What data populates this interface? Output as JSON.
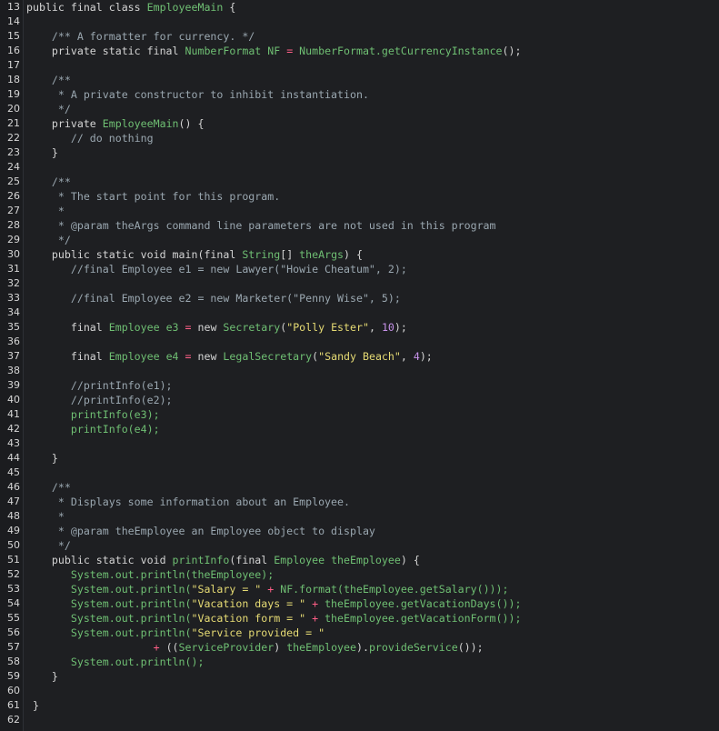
{
  "lines": [
    {
      "n": "13",
      "code": [
        [
          "kw",
          "public final class "
        ],
        [
          "ty",
          "EmployeeMain"
        ],
        [
          "pl",
          " {"
        ]
      ]
    },
    {
      "n": "14",
      "code": []
    },
    {
      "n": "15",
      "code": [
        [
          "cm",
          "    /** A formatter for currency. */"
        ]
      ]
    },
    {
      "n": "16",
      "code": [
        [
          "kw",
          "    private static final "
        ],
        [
          "ty",
          "NumberFormat NF "
        ],
        [
          "op",
          "="
        ],
        [
          "pl",
          " "
        ],
        [
          "ty",
          "NumberFormat.getCurrencyInstance"
        ],
        [
          "pl",
          "();"
        ]
      ]
    },
    {
      "n": "17",
      "code": []
    },
    {
      "n": "18",
      "code": [
        [
          "cm",
          "    /**"
        ]
      ]
    },
    {
      "n": "19",
      "code": [
        [
          "cm",
          "     * A private constructor to inhibit instantiation."
        ]
      ]
    },
    {
      "n": "20",
      "code": [
        [
          "cm",
          "     */"
        ]
      ]
    },
    {
      "n": "21",
      "code": [
        [
          "kw",
          "    private "
        ],
        [
          "ty",
          "EmployeeMain"
        ],
        [
          "pl",
          "() {"
        ]
      ]
    },
    {
      "n": "22",
      "code": [
        [
          "cm",
          "       // do nothing"
        ]
      ]
    },
    {
      "n": "23",
      "code": [
        [
          "pl",
          "    }"
        ]
      ]
    },
    {
      "n": "24",
      "code": []
    },
    {
      "n": "25",
      "code": [
        [
          "cm",
          "    /**"
        ]
      ]
    },
    {
      "n": "26",
      "code": [
        [
          "cm",
          "     * The start point for this program."
        ]
      ]
    },
    {
      "n": "27",
      "code": [
        [
          "cm",
          "     *"
        ]
      ]
    },
    {
      "n": "28",
      "code": [
        [
          "cm",
          "     * @param theArgs command line parameters are not used in this program"
        ]
      ]
    },
    {
      "n": "29",
      "code": [
        [
          "cm",
          "     */"
        ]
      ]
    },
    {
      "n": "30",
      "code": [
        [
          "kw",
          "    public static void "
        ],
        [
          "pl",
          "main(final "
        ],
        [
          "ty",
          "String"
        ],
        [
          "pl",
          "[] "
        ],
        [
          "ty",
          "theArgs"
        ],
        [
          "pl",
          ") {"
        ]
      ]
    },
    {
      "n": "31",
      "code": [
        [
          "cm",
          "       //final Employee e1 = new Lawyer(\"Howie Cheatum\", 2);"
        ]
      ]
    },
    {
      "n": "32",
      "code": []
    },
    {
      "n": "33",
      "code": [
        [
          "cm",
          "       //final Employee e2 = new Marketer(\"Penny Wise\", 5);"
        ]
      ]
    },
    {
      "n": "34",
      "code": []
    },
    {
      "n": "35",
      "code": [
        [
          "kw",
          "       final "
        ],
        [
          "ty",
          "Employee e3 "
        ],
        [
          "op",
          "="
        ],
        [
          "kw",
          " new "
        ],
        [
          "ty",
          "Secretary"
        ],
        [
          "pl",
          "("
        ],
        [
          "str",
          "\"Polly Ester\""
        ],
        [
          "pl",
          ", "
        ],
        [
          "num",
          "10"
        ],
        [
          "pl",
          ");"
        ]
      ]
    },
    {
      "n": "36",
      "code": []
    },
    {
      "n": "37",
      "code": [
        [
          "kw",
          "       final "
        ],
        [
          "ty",
          "Employee e4 "
        ],
        [
          "op",
          "="
        ],
        [
          "kw",
          " new "
        ],
        [
          "ty",
          "LegalSecretary"
        ],
        [
          "pl",
          "("
        ],
        [
          "str",
          "\"Sandy Beach\""
        ],
        [
          "pl",
          ", "
        ],
        [
          "num",
          "4"
        ],
        [
          "pl",
          ");"
        ]
      ]
    },
    {
      "n": "38",
      "code": []
    },
    {
      "n": "39",
      "code": [
        [
          "cm",
          "       //printInfo(e1);"
        ]
      ]
    },
    {
      "n": "40",
      "code": [
        [
          "cm",
          "       //printInfo(e2);"
        ]
      ]
    },
    {
      "n": "41",
      "code": [
        [
          "ty",
          "       printInfo(e3);"
        ]
      ]
    },
    {
      "n": "42",
      "code": [
        [
          "ty",
          "       printInfo(e4);"
        ]
      ]
    },
    {
      "n": "43",
      "code": []
    },
    {
      "n": "44",
      "code": [
        [
          "pl",
          "    }"
        ]
      ]
    },
    {
      "n": "45",
      "code": []
    },
    {
      "n": "46",
      "code": [
        [
          "cm",
          "    /**"
        ]
      ]
    },
    {
      "n": "47",
      "code": [
        [
          "cm",
          "     * Displays some information about an Employee."
        ]
      ]
    },
    {
      "n": "48",
      "code": [
        [
          "cm",
          "     *"
        ]
      ]
    },
    {
      "n": "49",
      "code": [
        [
          "cm",
          "     * @param theEmployee an Employee object to display"
        ]
      ]
    },
    {
      "n": "50",
      "code": [
        [
          "cm",
          "     */"
        ]
      ]
    },
    {
      "n": "51",
      "code": [
        [
          "kw",
          "    public static void "
        ],
        [
          "ty",
          "printInfo"
        ],
        [
          "pl",
          "(final "
        ],
        [
          "ty",
          "Employee theEmployee"
        ],
        [
          "pl",
          ") {"
        ]
      ]
    },
    {
      "n": "52",
      "code": [
        [
          "ty",
          "       System.out.println(theEmployee);"
        ]
      ]
    },
    {
      "n": "53",
      "code": [
        [
          "ty",
          "       System.out.println("
        ],
        [
          "str",
          "\"Salary = \""
        ],
        [
          "op",
          " + "
        ],
        [
          "ty",
          "NF.format(theEmployee.getSalary()));"
        ]
      ]
    },
    {
      "n": "54",
      "code": [
        [
          "ty",
          "       System.out.println("
        ],
        [
          "str",
          "\"Vacation days = \""
        ],
        [
          "op",
          " + "
        ],
        [
          "ty",
          "theEmployee.getVacationDays());"
        ]
      ]
    },
    {
      "n": "55",
      "code": [
        [
          "ty",
          "       System.out.println("
        ],
        [
          "str",
          "\"Vacation form = \""
        ],
        [
          "op",
          " + "
        ],
        [
          "ty",
          "theEmployee.getVacationForm());"
        ]
      ]
    },
    {
      "n": "56",
      "code": [
        [
          "ty",
          "       System.out.println("
        ],
        [
          "str",
          "\"Service provided = \""
        ]
      ]
    },
    {
      "n": "57",
      "code": [
        [
          "op",
          "                    + "
        ],
        [
          "pl",
          "(("
        ],
        [
          "ty",
          "ServiceProvider"
        ],
        [
          "pl",
          ") "
        ],
        [
          "ty",
          "theEmployee"
        ],
        [
          "pl",
          ")."
        ],
        [
          "ty",
          "provideService"
        ],
        [
          "pl",
          "());"
        ]
      ]
    },
    {
      "n": "58",
      "code": [
        [
          "ty",
          "       System.out.println();"
        ]
      ]
    },
    {
      "n": "59",
      "code": [
        [
          "pl",
          "    }"
        ]
      ]
    },
    {
      "n": "60",
      "code": []
    },
    {
      "n": "61",
      "code": [
        [
          "pl",
          " }"
        ]
      ]
    },
    {
      "n": "62",
      "code": []
    }
  ],
  "colors": {
    "background": "#1e1f22",
    "keyword": "#d4d4d4",
    "type": "#6fbf73",
    "comment": "#9aa7b0",
    "string": "#e6db74",
    "number": "#c792ea",
    "operator": "#ff5f87"
  }
}
